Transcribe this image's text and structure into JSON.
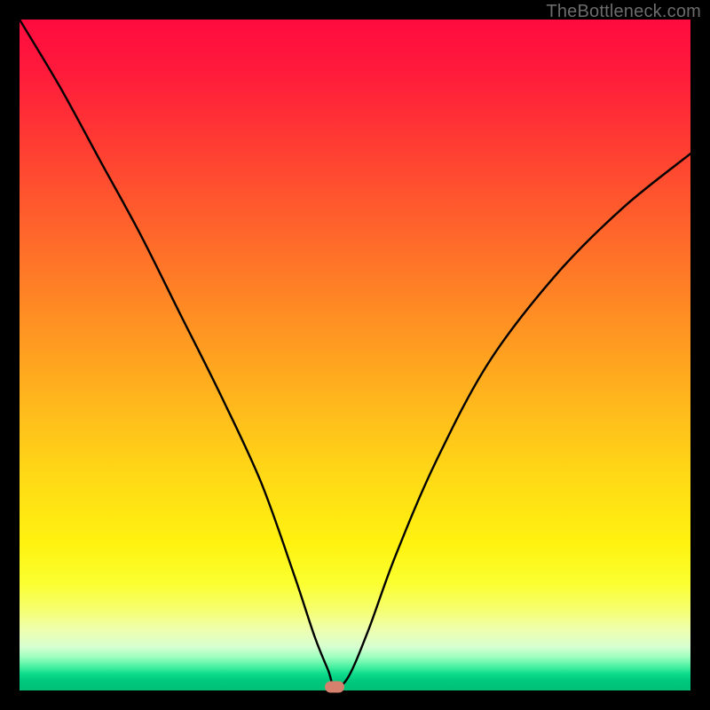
{
  "watermark": "TheBottleneck.com",
  "chart_data": {
    "type": "line",
    "title": "",
    "xlabel": "",
    "ylabel": "",
    "xlim": [
      0,
      100
    ],
    "ylim": [
      0,
      100
    ],
    "grid": false,
    "legend": false,
    "background_gradient": {
      "stops": [
        {
          "pos": 0,
          "color": "#ff0b3f"
        },
        {
          "pos": 50,
          "color": "#ff9a21"
        },
        {
          "pos": 80,
          "color": "#fff210"
        },
        {
          "pos": 100,
          "color": "#00c076"
        }
      ]
    },
    "series": [
      {
        "name": "bottleneck-curve",
        "color": "#000000",
        "x": [
          0,
          6,
          12,
          18,
          24,
          30,
          36,
          41,
          44,
          46,
          47,
          49,
          52,
          56,
          62,
          70,
          80,
          90,
          100
        ],
        "y": [
          100,
          90,
          79,
          68,
          56,
          44,
          31,
          17,
          8,
          3,
          0.5,
          2,
          9,
          20,
          34,
          49,
          62,
          72,
          80
        ]
      }
    ],
    "marker": {
      "x": 47,
      "y": 0.5,
      "shape": "pill",
      "color": "#d6806e"
    },
    "annotations": []
  }
}
